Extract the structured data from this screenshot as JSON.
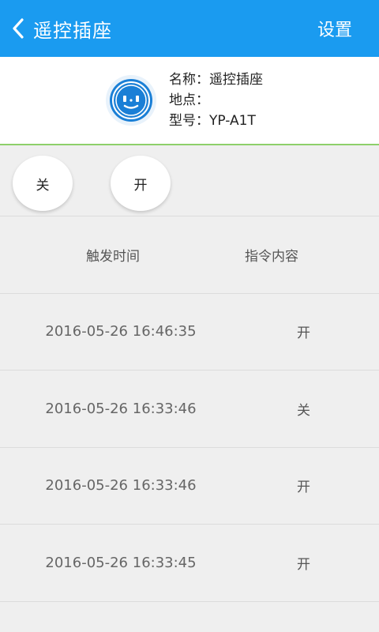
{
  "header": {
    "title": "遥控插座",
    "settings_label": "设置",
    "back_icon": "chevron-left-icon",
    "background": "#1a9bf0"
  },
  "device": {
    "icon": "socket-icon",
    "name_label": "名称：",
    "name_value": "遥控插座",
    "location_label": "地点：",
    "location_value": "",
    "model_label": "型号：",
    "model_value": "YP-A1T",
    "divider_color": "#8ed06a"
  },
  "controls": {
    "off_label": "关",
    "on_label": "开"
  },
  "table": {
    "headers": {
      "time": "触发时间",
      "command": "指令内容"
    },
    "rows": [
      {
        "time": "2016-05-26 16:46:35",
        "command": "开"
      },
      {
        "time": "2016-05-26 16:33:46",
        "command": "关"
      },
      {
        "time": "2016-05-26 16:33:46",
        "command": "开"
      },
      {
        "time": "2016-05-26 16:33:45",
        "command": "开"
      }
    ]
  }
}
